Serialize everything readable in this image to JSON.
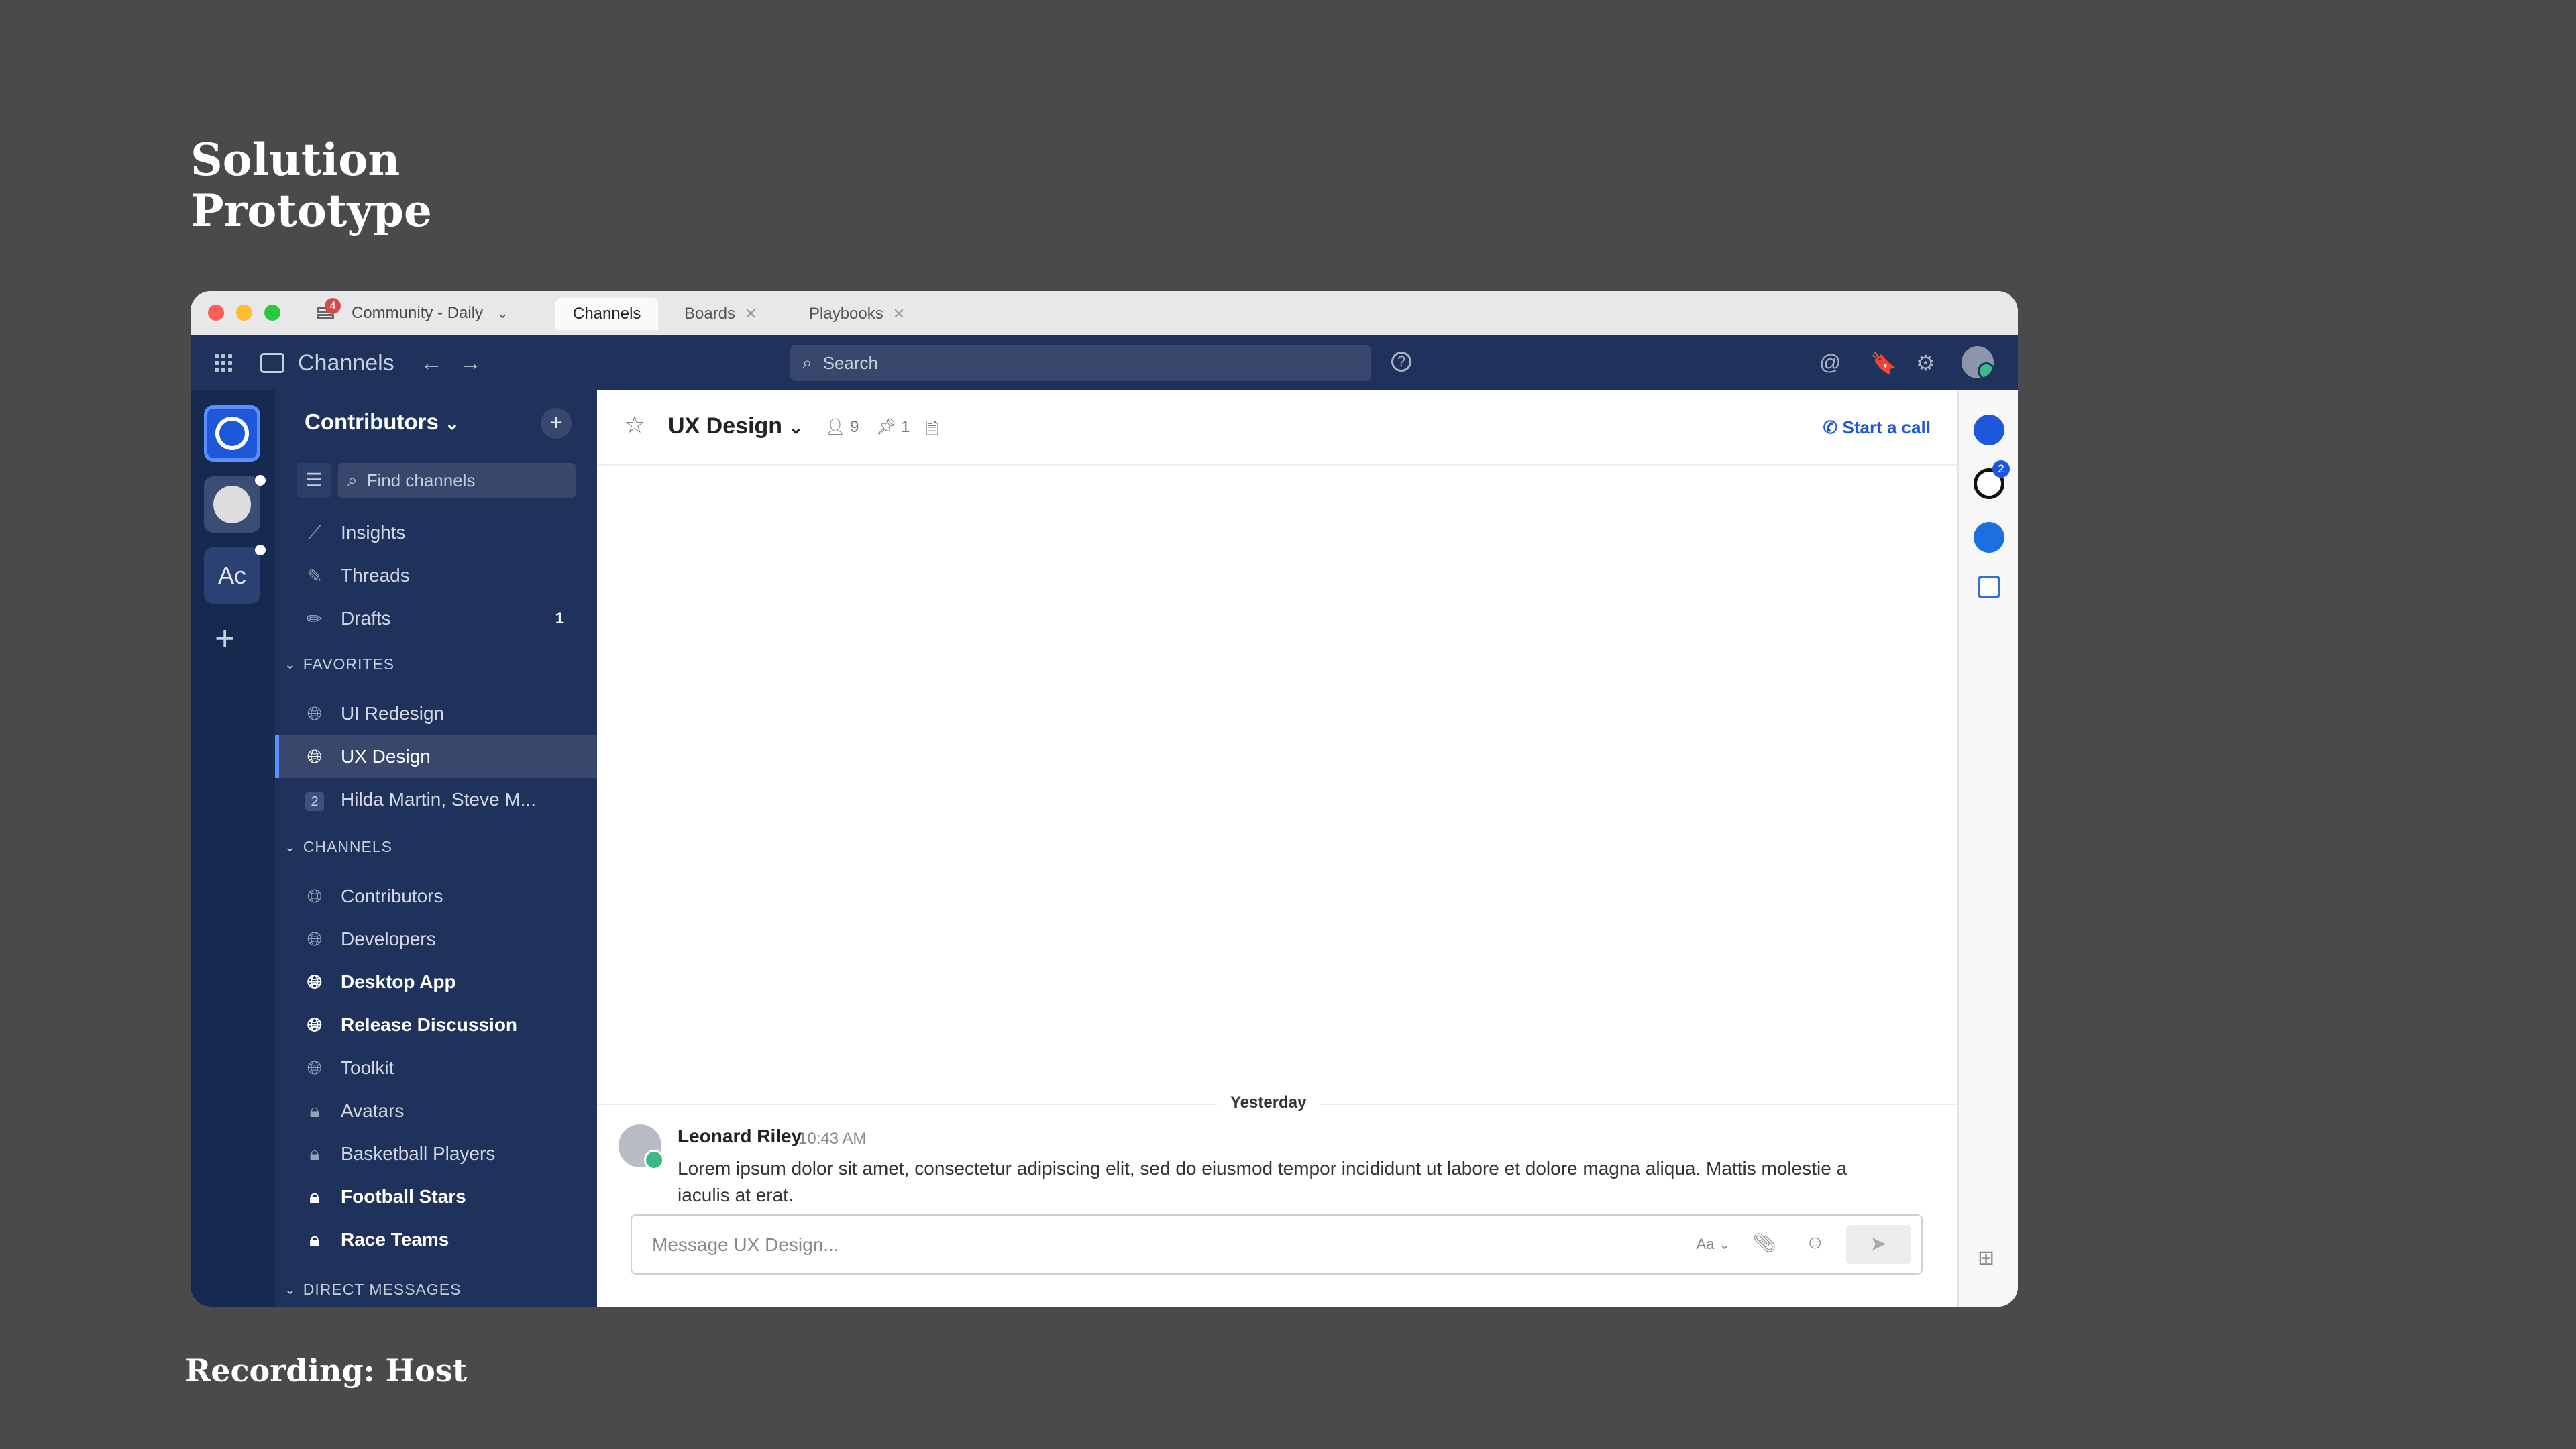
{
  "slide": {
    "title_line1": "Solution",
    "title_line2": "Prototype",
    "footer": "Recording: Host"
  },
  "titlebar": {
    "server_name": "Community - Daily",
    "server_badge": "4",
    "tabs": [
      {
        "label": "Channels",
        "active": true
      },
      {
        "label": "Boards",
        "closable": true
      },
      {
        "label": "Playbooks",
        "closable": true
      }
    ]
  },
  "globalbar": {
    "product": "Channels",
    "search_placeholder": "Search"
  },
  "teams": [
    {
      "name": "active-team"
    },
    {
      "name": "incognito-team"
    },
    {
      "initials": "Ac"
    }
  ],
  "sidebar": {
    "team_name": "Contributors",
    "find_placeholder": "Find channels",
    "top_items": [
      {
        "label": "Insights",
        "icon": "insights-icon"
      },
      {
        "label": "Threads",
        "icon": "threads-icon"
      },
      {
        "label": "Drafts",
        "icon": "drafts-icon",
        "count": "1"
      }
    ],
    "favorites_header": "FAVORITES",
    "favorites": [
      {
        "label": "UI Redesign",
        "icon": "globe-icon"
      },
      {
        "label": "UX Design",
        "icon": "globe-icon",
        "active": true
      },
      {
        "label": "Hilda Martin, Steve M...",
        "icon": "group-dm-icon",
        "member_count": "2"
      }
    ],
    "channels_header": "CHANNELS",
    "channels": [
      {
        "label": "Contributors",
        "icon": "globe-icon"
      },
      {
        "label": "Developers",
        "icon": "globe-icon"
      },
      {
        "label": "Desktop App",
        "icon": "globe-icon",
        "unread": true
      },
      {
        "label": "Release Discussion",
        "icon": "globe-icon",
        "unread": true
      },
      {
        "label": "Toolkit",
        "icon": "globe-icon"
      },
      {
        "label": "Avatars",
        "icon": "lock-icon"
      },
      {
        "label": "Basketball Players",
        "icon": "lock-icon"
      },
      {
        "label": "Football Stars",
        "icon": "lock-icon",
        "unread": true
      },
      {
        "label": "Race Teams",
        "icon": "lock-icon",
        "unread": true
      }
    ],
    "dm_header": "DIRECT MESSAGES"
  },
  "channel": {
    "name": "UX Design",
    "member_count": "9",
    "pinned_count": "1",
    "call_label": "Start a call",
    "day_separator": "Yesterday",
    "post": {
      "author": "Leonard Riley",
      "time": "10:43 AM",
      "text": "Lorem ipsum dolor sit amet, consectetur adipiscing elit, sed do eiusmod tempor incididunt ut labore et dolore magna aliqua. Mattis molestie a iaculis at erat."
    },
    "composer_placeholder": "Message UX Design...",
    "format_label": "Aa"
  },
  "appbar": {
    "badge": "2"
  },
  "colors": {
    "sidebar": "#1e325c",
    "teambar": "#162a50",
    "accent": "#1c58d9",
    "online": "#3db887",
    "badge_red": "#d24b4e"
  }
}
